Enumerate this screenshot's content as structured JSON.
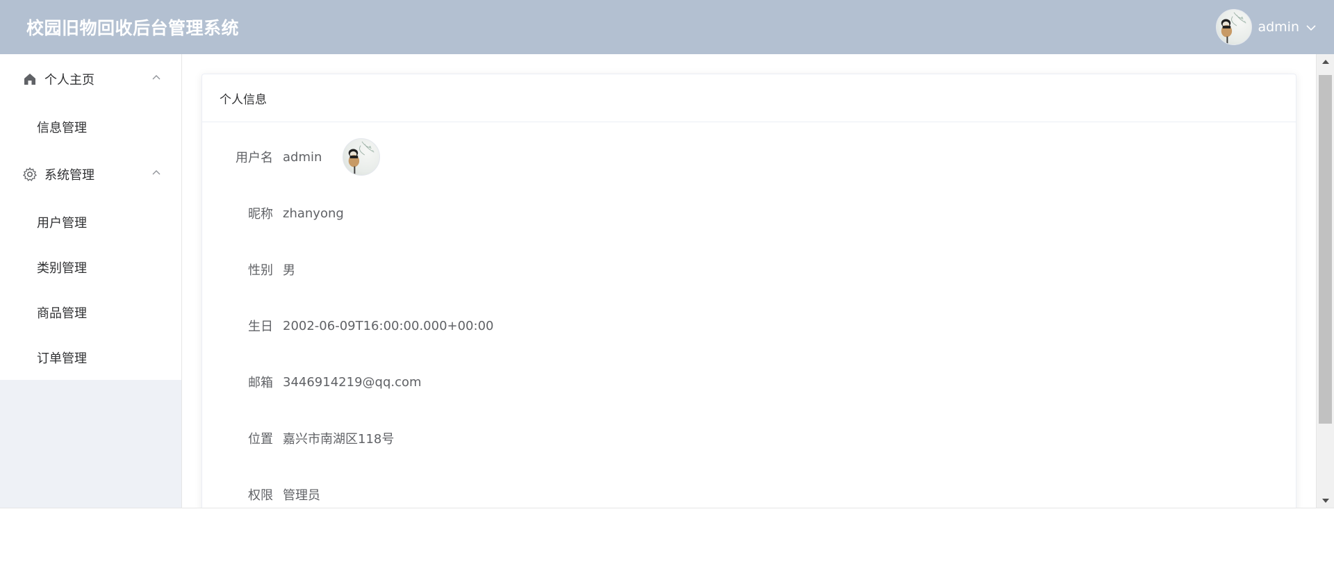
{
  "header": {
    "title": "校园旧物回收后台管理系统",
    "username": "admin",
    "dropdown_icon": "chevron-down-icon"
  },
  "sidebar": {
    "groups": [
      {
        "label": "个人主页",
        "icon": "home-icon",
        "expanded": true,
        "items": [
          {
            "label": "信息管理"
          }
        ]
      },
      {
        "label": "系统管理",
        "icon": "gear-icon",
        "expanded": true,
        "items": [
          {
            "label": "用户管理"
          },
          {
            "label": "类别管理"
          },
          {
            "label": "商品管理"
          },
          {
            "label": "订单管理"
          }
        ]
      }
    ]
  },
  "main": {
    "card_title": "个人信息",
    "fields": [
      {
        "label": "用户名",
        "value": "admin"
      },
      {
        "label": "昵称",
        "value": "zhanyong"
      },
      {
        "label": "性别",
        "value": "男"
      },
      {
        "label": "生日",
        "value": "2002-06-09T16:00:00.000+00:00"
      },
      {
        "label": "邮箱",
        "value": "3446914219@qq.com"
      },
      {
        "label": "位置",
        "value": "嘉兴市南湖区118号"
      },
      {
        "label": "权限",
        "value": "管理员"
      }
    ]
  },
  "colors": {
    "header_bg": "#b3c0d1",
    "sidebar_bg": "#eef1f6",
    "text_primary": "#303133",
    "text_regular": "#606266"
  }
}
